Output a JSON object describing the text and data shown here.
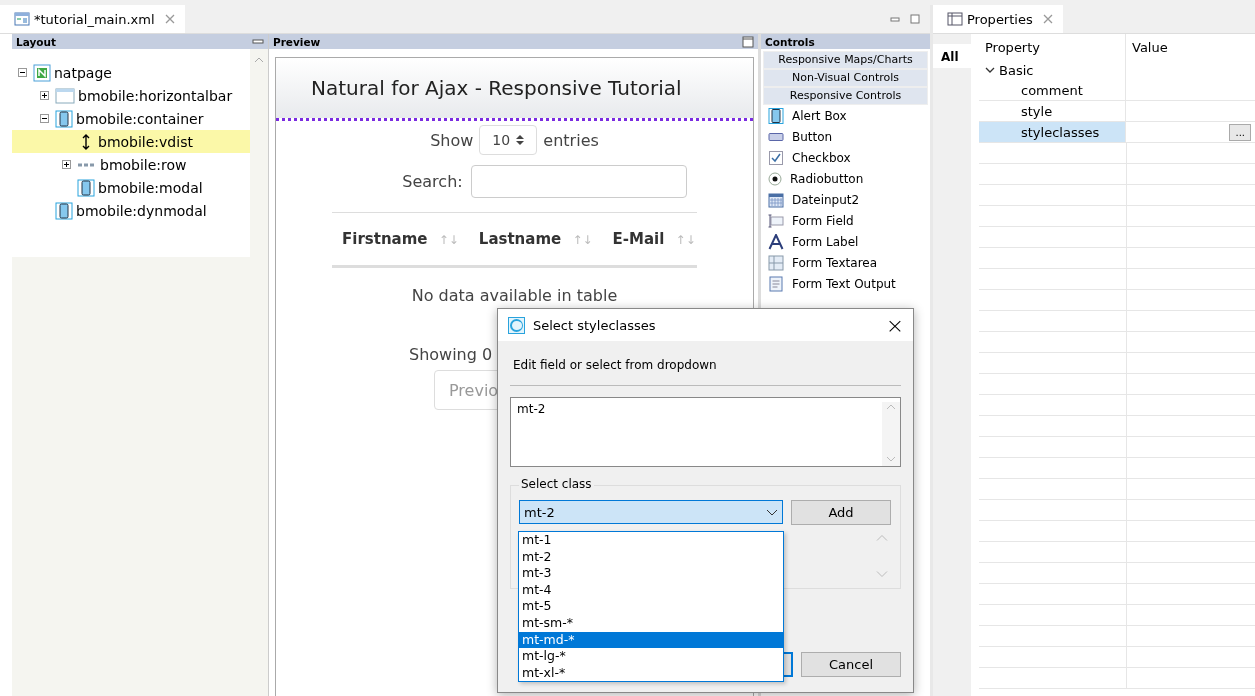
{
  "editor_tab": {
    "title": "*tutorial_main.xml"
  },
  "layout_pane": {
    "title": "Layout",
    "tree": [
      {
        "label": "natpage",
        "kind": "page",
        "expandable": true,
        "expanded": true,
        "selected": false,
        "children": [
          {
            "label": "bmobile:horizontalbar",
            "kind": "bar",
            "expandable": true,
            "expanded": false,
            "selected": false
          },
          {
            "label": "bmobile:container",
            "kind": "device",
            "expandable": true,
            "expanded": true,
            "selected": false,
            "children": [
              {
                "label": "bmobile:vdist",
                "kind": "arrows",
                "expandable": false,
                "selected": true
              },
              {
                "label": "bmobile:row",
                "kind": "row",
                "expandable": true,
                "expanded": false,
                "selected": false
              },
              {
                "label": "bmobile:modal",
                "kind": "device",
                "expandable": false,
                "selected": false
              }
            ]
          },
          {
            "label": "bmobile:dynmodal",
            "kind": "device",
            "expandable": false,
            "selected": false
          }
        ]
      }
    ]
  },
  "preview_pane": {
    "title": "Preview",
    "page_title": "Natural for Ajax - Responsive Tutorial",
    "show_label": "Show",
    "entries_value": "10",
    "entries_label": "entries",
    "search_label": "Search:",
    "columns": [
      "Firstname",
      "Lastname",
      "E-Mail"
    ],
    "sort_icon": "↑↓",
    "empty_text": "No data available in table",
    "info_text": "Showing 0",
    "prev_button": "Previo"
  },
  "controls_pane": {
    "title": "Controls",
    "categories": [
      "Responsive Maps/Charts",
      "Non-Visual Controls",
      "Responsive Controls"
    ],
    "items": [
      {
        "label": "Alert Box",
        "kind": "device"
      },
      {
        "label": "Button",
        "kind": "button"
      },
      {
        "label": "Checkbox",
        "kind": "checkbox"
      },
      {
        "label": "Radiobutton",
        "kind": "radio"
      },
      {
        "label": "Dateinput2",
        "kind": "calendar"
      },
      {
        "label": "Form Field",
        "kind": "field"
      },
      {
        "label": "Form Label",
        "kind": "letter"
      },
      {
        "label": "Form Textarea",
        "kind": "textarea"
      },
      {
        "label": "Form Text Output",
        "kind": "document"
      }
    ]
  },
  "properties_view": {
    "title": "Properties",
    "side_tab": "All",
    "columns": [
      "Property",
      "Value"
    ],
    "group": {
      "label": "Basic",
      "expanded": true
    },
    "rows": [
      {
        "name": "comment",
        "selected": false
      },
      {
        "name": "style",
        "selected": false
      },
      {
        "name": "styleclasses",
        "selected": true,
        "button_label": "..."
      }
    ]
  },
  "dialog": {
    "title": "Select styleclasses",
    "close": "×",
    "instruction": "Edit field or select from dropdown",
    "field_value": "mt-2",
    "group_label": "Select class",
    "combo_value": "mt-2",
    "add_button": "Add",
    "cancel_button": "Cancel",
    "options": [
      {
        "label": "mt-1",
        "selected": false
      },
      {
        "label": "mt-2",
        "selected": false
      },
      {
        "label": "mt-3",
        "selected": false
      },
      {
        "label": "mt-4",
        "selected": false
      },
      {
        "label": "mt-5",
        "selected": false
      },
      {
        "label": "mt-sm-*",
        "selected": false
      },
      {
        "label": "mt-md-*",
        "selected": true
      },
      {
        "label": "mt-lg-*",
        "selected": false
      },
      {
        "label": "mt-xl-*",
        "selected": false
      }
    ]
  }
}
